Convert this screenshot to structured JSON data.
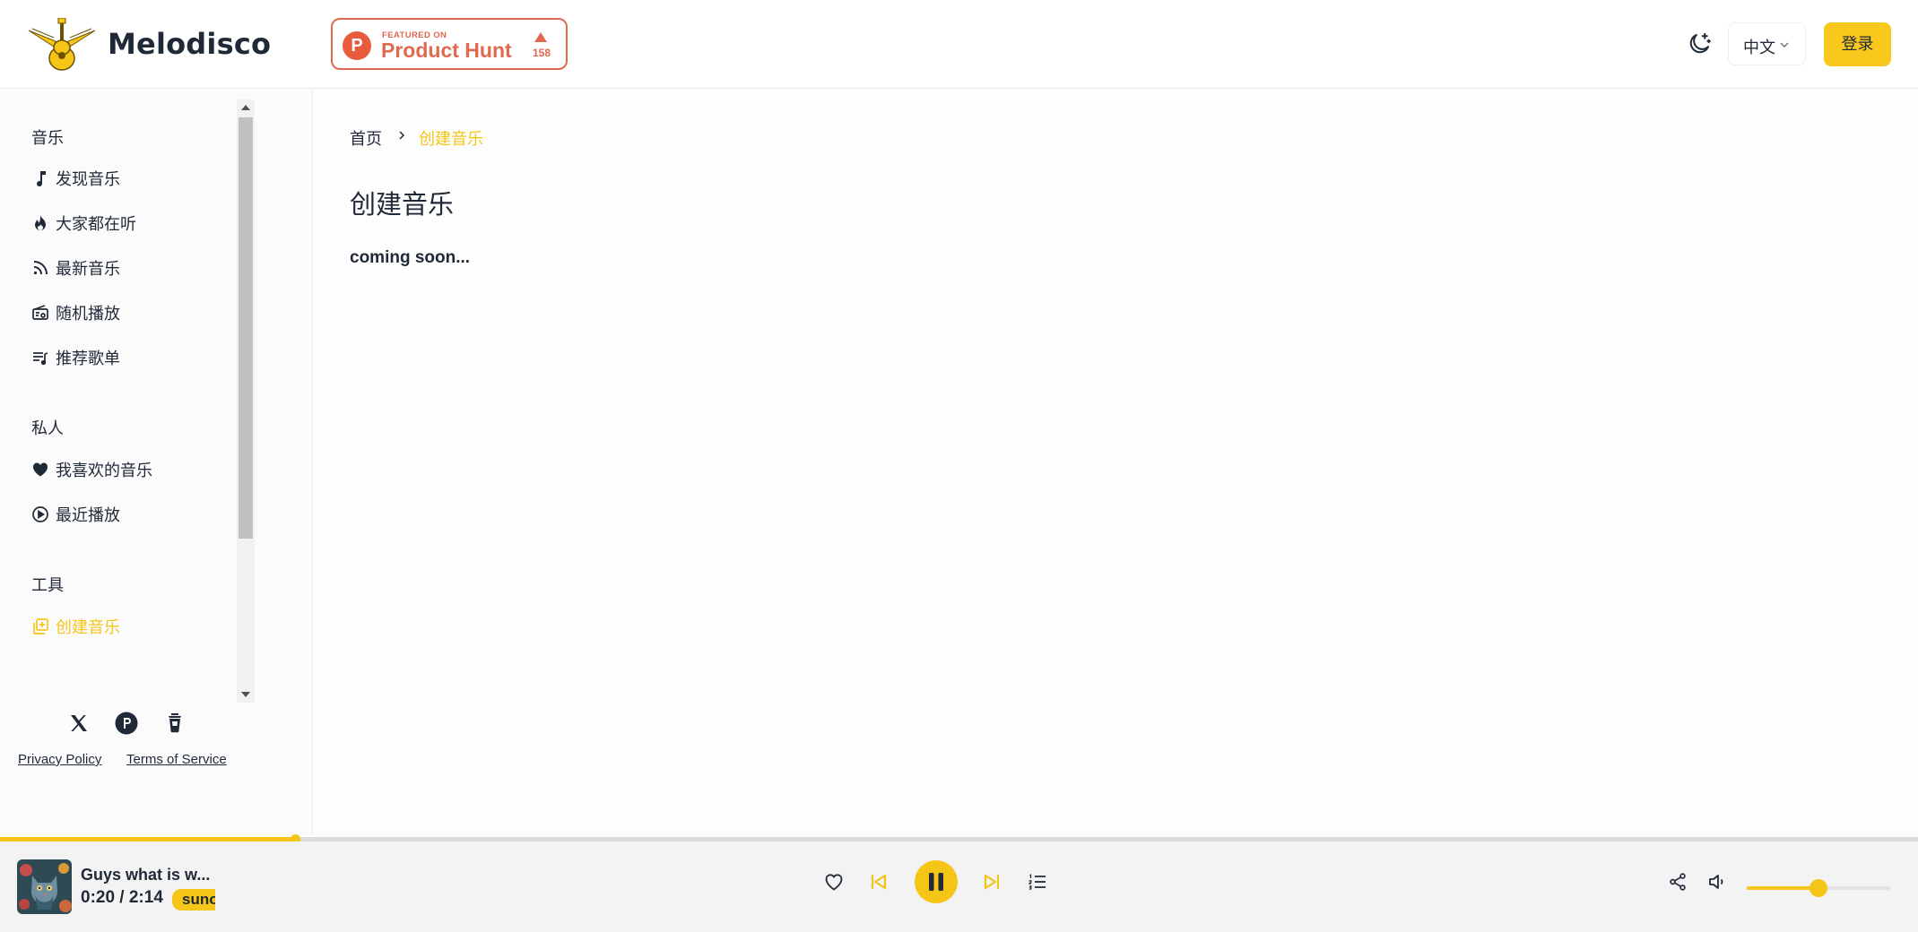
{
  "header": {
    "app_name": "Melodisco",
    "product_hunt": {
      "featured_label": "FEATURED ON",
      "name": "Product Hunt",
      "upvotes": "158"
    },
    "language": "中文",
    "login_label": "登录"
  },
  "sidebar": {
    "sections": [
      {
        "title": "音乐",
        "items": [
          {
            "label": "发现音乐",
            "icon": "music-note-icon"
          },
          {
            "label": "大家都在听",
            "icon": "flame-icon"
          },
          {
            "label": "最新音乐",
            "icon": "rss-icon"
          },
          {
            "label": "随机播放",
            "icon": "radio-icon"
          },
          {
            "label": "推荐歌单",
            "icon": "playlist-icon"
          }
        ]
      },
      {
        "title": "私人",
        "items": [
          {
            "label": "我喜欢的音乐",
            "icon": "heart-icon"
          },
          {
            "label": "最近播放",
            "icon": "play-circle-icon"
          }
        ]
      },
      {
        "title": "工具",
        "items": [
          {
            "label": "创建音乐",
            "icon": "library-add-icon",
            "active": true
          }
        ]
      }
    ],
    "social": [
      "x-icon",
      "product-hunt-icon",
      "coffee-icon"
    ],
    "footer": {
      "privacy": "Privacy Policy",
      "terms": "Terms of Service"
    }
  },
  "breadcrumb": {
    "home": "首页",
    "current": "创建音乐"
  },
  "page": {
    "title": "创建音乐",
    "message": "coming soon..."
  },
  "player": {
    "title": "Guys what is w...",
    "time": "0:20 / 2:14",
    "tag": "suno",
    "progress": 0.154,
    "volume": 0.5
  },
  "colors": {
    "accent": "#f5c518",
    "product_hunt": "#e0694f"
  }
}
